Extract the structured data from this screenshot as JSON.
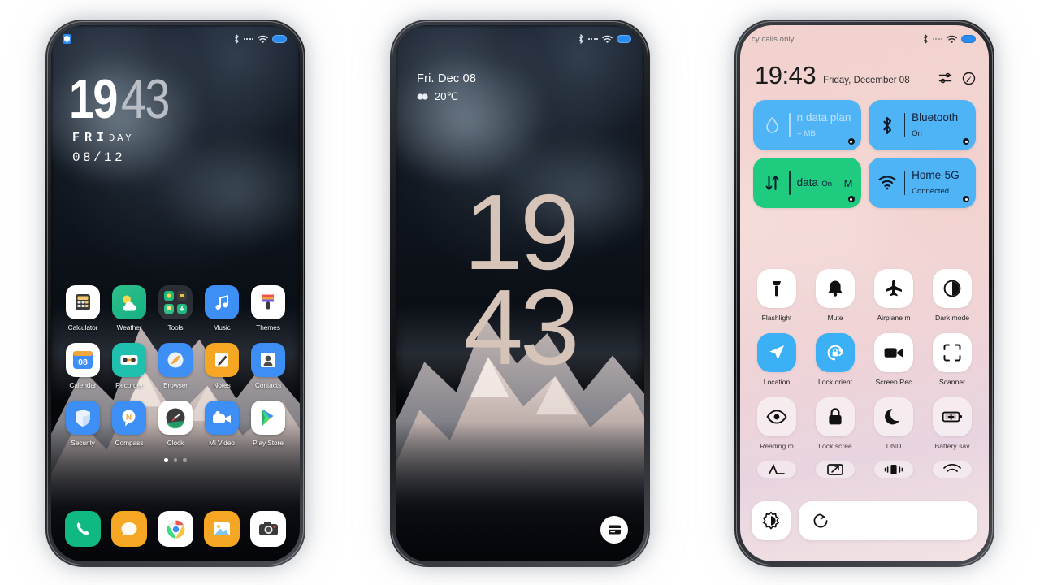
{
  "phone1": {
    "name": "home-screen",
    "status": {
      "left_icon": "security-shield-icon",
      "bluetooth": "bluetooth-icon",
      "signal": "signal-dots-icon",
      "wifi": "wifi-icon",
      "battery": "battery-icon"
    },
    "clock": {
      "hours": "19",
      "minutes": "43",
      "day_strong": "FRI",
      "day_rest": "DAY",
      "date": "08/12"
    },
    "rows": [
      [
        {
          "label": "Calculator",
          "icon": "calculator-icon"
        },
        {
          "label": "Weather",
          "icon": "weather-icon"
        },
        {
          "label": "Tools",
          "icon": "tools-folder-icon"
        },
        {
          "label": "Music",
          "icon": "music-icon"
        },
        {
          "label": "Themes",
          "icon": "themes-icon"
        }
      ],
      [
        {
          "label": "Calendar",
          "icon": "calendar-icon",
          "badge": "08"
        },
        {
          "label": "Recorder",
          "icon": "recorder-icon"
        },
        {
          "label": "Browser",
          "icon": "browser-icon"
        },
        {
          "label": "Notes",
          "icon": "notes-icon"
        },
        {
          "label": "Contacts",
          "icon": "contacts-icon"
        }
      ],
      [
        {
          "label": "Security",
          "icon": "security-icon"
        },
        {
          "label": "Compass",
          "icon": "compass-icon"
        },
        {
          "label": "Clock",
          "icon": "clock-icon"
        },
        {
          "label": "Mi Video",
          "icon": "mi-video-icon"
        },
        {
          "label": "Play Store",
          "icon": "play-store-icon"
        }
      ]
    ],
    "page_dots": {
      "count": 3,
      "active": 0
    },
    "dock": [
      {
        "label": "Phone",
        "icon": "phone-icon"
      },
      {
        "label": "Messages",
        "icon": "messages-icon"
      },
      {
        "label": "Chrome",
        "icon": "chrome-icon"
      },
      {
        "label": "Gallery",
        "icon": "gallery-icon"
      },
      {
        "label": "Camera",
        "icon": "camera-icon"
      }
    ]
  },
  "phone2": {
    "name": "lock-screen",
    "date_line": "Fri. Dec  08",
    "weather_icon": "cloudy-icon",
    "weather_temp": "20℃",
    "clock_top": "19",
    "clock_bottom": "43",
    "wallet_icon": "wallet-card-icon"
  },
  "phone3": {
    "name": "control-center",
    "status_text": "cy calls only",
    "time": "19:43",
    "date": "Friday, December 08",
    "head_icons": [
      {
        "name": "settings-sliders-icon"
      },
      {
        "name": "edit-pencil-icon"
      }
    ],
    "tiles": [
      {
        "title": "n data plan",
        "subtitle": "-- MB",
        "icon": "data-drop-icon",
        "color": "#4fb4f5",
        "state": "dim"
      },
      {
        "title": "Bluetooth",
        "subtitle": "On",
        "icon": "bluetooth-icon",
        "color": "#4fb4f5",
        "state": "on"
      },
      {
        "title": "data",
        "subtitle": "On",
        "icon": "mobile-data-icon",
        "color": "#1fcb7e",
        "state": "on",
        "right": "M"
      },
      {
        "title": "Home-5G",
        "subtitle": "Connected",
        "icon": "wifi-icon",
        "color": "#4fb4f5",
        "state": "on"
      }
    ],
    "toggle_rows": [
      [
        {
          "label": "Flashlight",
          "icon": "flashlight-icon",
          "active": false
        },
        {
          "label": "Mute",
          "icon": "bell-icon",
          "active": false
        },
        {
          "label": "Airplane m",
          "icon": "airplane-icon",
          "active": false
        },
        {
          "label": "Dark mode",
          "icon": "dark-mode-icon",
          "active": false
        }
      ],
      [
        {
          "label": "Location",
          "icon": "location-icon",
          "active": true
        },
        {
          "label": "Lock orient",
          "icon": "lock-orient-icon",
          "active": true
        },
        {
          "label": "Screen Rec",
          "icon": "screen-rec-icon",
          "active": false
        },
        {
          "label": "Scanner",
          "icon": "scanner-icon",
          "active": false
        }
      ],
      [
        {
          "label": "Reading m",
          "icon": "eye-icon",
          "active": false
        },
        {
          "label": "Lock scree",
          "icon": "lock-icon",
          "active": false
        },
        {
          "label": "DND",
          "icon": "moon-icon",
          "active": false
        },
        {
          "label": "Battery sav",
          "icon": "battery-saver-icon",
          "active": false
        }
      ]
    ],
    "cut_row": [
      {
        "icon": "sound-wave-icon"
      },
      {
        "icon": "cast-icon"
      },
      {
        "icon": "vibrate-icon"
      },
      {
        "icon": "hotspot-icon"
      }
    ],
    "bottom": {
      "brightness_icon": "brightness-auto-icon",
      "slider_icon": "sync-rotate-icon"
    },
    "accent_blue": "#4fb4f5",
    "accent_green": "#1fcb7e"
  }
}
